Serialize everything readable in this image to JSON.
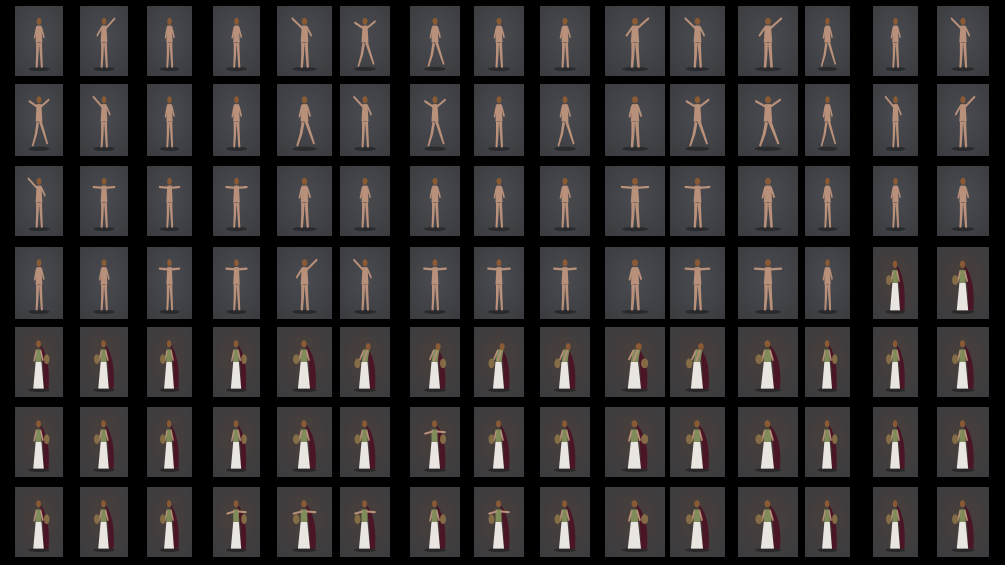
{
  "contact_sheet": {
    "rows": [
      {
        "set": "nude",
        "poses": [
          "stand",
          "reach",
          "stand",
          "stand",
          "reach",
          "lunge",
          "step",
          "stand",
          "stand",
          "reach",
          "reach",
          "reach",
          "step",
          "stand",
          "reach"
        ]
      },
      {
        "set": "nude",
        "poses": [
          "lunge",
          "reach",
          "stand",
          "stand",
          "step",
          "reach",
          "lunge",
          "stand",
          "step",
          "stand",
          "lunge",
          "lunge",
          "step",
          "reach",
          "reach"
        ]
      },
      {
        "set": "nude",
        "poses": [
          "reach",
          "arms-out",
          "arms-out",
          "arms-out",
          "stand",
          "stand",
          "stand",
          "stand",
          "stand",
          "arms-out",
          "arms-out",
          "stand",
          "stand",
          "stand",
          "stand"
        ]
      },
      {
        "set": "nude",
        "poses": [
          "stand",
          "stand",
          "arms-out",
          "arms-out",
          "reach",
          "reach",
          "arms-out",
          "arms-out",
          "arms-out",
          "stand",
          "arms-out",
          "arms-out",
          "stand",
          "stand",
          "stand"
        ]
      },
      {
        "set": "costume",
        "poses": [
          "stand",
          "stand",
          "stand",
          "stand",
          "stand",
          "bow",
          "bow",
          "bow",
          "bow",
          "bow",
          "bow",
          "stand",
          "stand",
          "stand",
          "stand"
        ]
      },
      {
        "set": "costume",
        "poses": [
          "stand",
          "stand",
          "stand",
          "stand",
          "stand",
          "stand",
          "arms-out",
          "stand",
          "stand",
          "stand",
          "stand",
          "stand",
          "stand",
          "stand",
          "stand"
        ]
      },
      {
        "set": "costume",
        "poses": [
          "stand",
          "stand",
          "stand",
          "arms-out",
          "arms-out",
          "arms-out",
          "stand",
          "arms-out",
          "stand",
          "stand",
          "stand",
          "stand",
          "stand",
          "stand",
          "stand"
        ]
      }
    ],
    "costume_override": {
      "row": 3,
      "cols": [
        13,
        14
      ]
    },
    "colors": {
      "background": "#000000",
      "backdrop": "#3b3c40",
      "backdrop_warm": "#4a3f3a",
      "skin": "#b9907a",
      "hair": "#8a5a35",
      "dress": "#e9e6e2",
      "bodice": "#7f8c5a",
      "cloak": "#4a1626",
      "shield": "#8b7248"
    }
  }
}
